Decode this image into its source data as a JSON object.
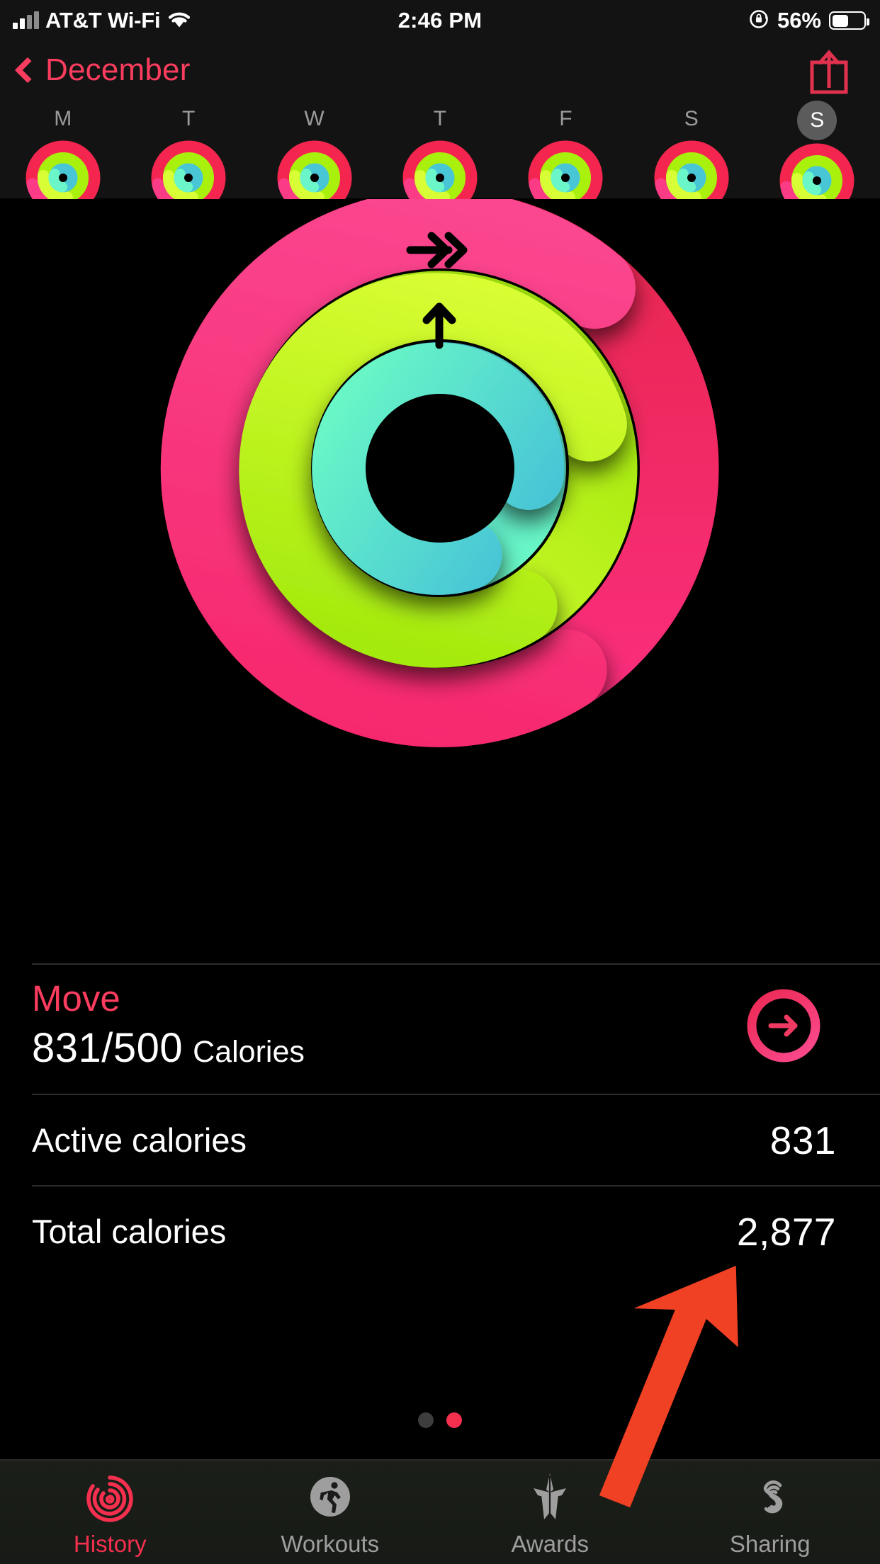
{
  "statusbar": {
    "carrier": "AT&T Wi-Fi",
    "time": "2:46 PM",
    "battery_percent": "56%",
    "signal_icon": "cellular-bars-icon",
    "wifi_icon": "wifi-icon",
    "rotation_lock_icon": "rotation-lock-icon",
    "battery_icon": "battery-icon"
  },
  "navbar": {
    "back_label": "December",
    "back_icon": "chevron-left-icon",
    "share_icon": "share-icon",
    "accent": "#fa3d5e"
  },
  "week": {
    "days": [
      {
        "letter": "M",
        "today": false,
        "move": 1.0,
        "exercise": 1.0,
        "stand": 1.0
      },
      {
        "letter": "T",
        "today": false,
        "move": 1.0,
        "exercise": 1.0,
        "stand": 1.0
      },
      {
        "letter": "W",
        "today": false,
        "move": 1.0,
        "exercise": 1.0,
        "stand": 1.0
      },
      {
        "letter": "T",
        "today": false,
        "move": 1.0,
        "exercise": 1.0,
        "stand": 1.0
      },
      {
        "letter": "F",
        "today": false,
        "move": 1.0,
        "exercise": 1.0,
        "stand": 1.0
      },
      {
        "letter": "S",
        "today": false,
        "move": 1.0,
        "exercise": 1.0,
        "stand": 1.0
      },
      {
        "letter": "S",
        "today": true,
        "move": 1.0,
        "exercise": 1.0,
        "stand": 1.0
      }
    ]
  },
  "rings": {
    "move_icon": "arrow-right-icon",
    "exercise_icon": "double-chevron-right-icon",
    "stand_icon": "arrow-up-icon",
    "move_color": "#f2184f",
    "move_color_2": "#fb2576",
    "exercise_color": "#a8f30b",
    "exercise_color_2": "#d2ff2e",
    "stand_color": "#4ecfd8",
    "stand_color_2": "#63f4c8",
    "move_progress": 1.66,
    "exercise_progress": 1.62,
    "stand_progress": 1.58
  },
  "summary": {
    "move": {
      "title": "Move",
      "value": "831/500",
      "unit": "Calories",
      "detail_icon": "arrow-right-circle-icon"
    },
    "stats": [
      {
        "label": "Active calories",
        "value": "831"
      },
      {
        "label": "Total calories",
        "value": "2,877"
      }
    ]
  },
  "pager": {
    "count": 2,
    "active_index": 1
  },
  "tabbar": {
    "items": [
      {
        "label": "History",
        "icon": "activity-rings-icon",
        "active": true
      },
      {
        "label": "Workouts",
        "icon": "running-person-icon",
        "active": false
      },
      {
        "label": "Awards",
        "icon": "award-star-icon",
        "active": false
      },
      {
        "label": "Sharing",
        "icon": "sharing-s-icon",
        "active": false
      }
    ]
  },
  "annotation": {
    "arrow_color": "#f04124",
    "points_at": "Total calories value"
  }
}
